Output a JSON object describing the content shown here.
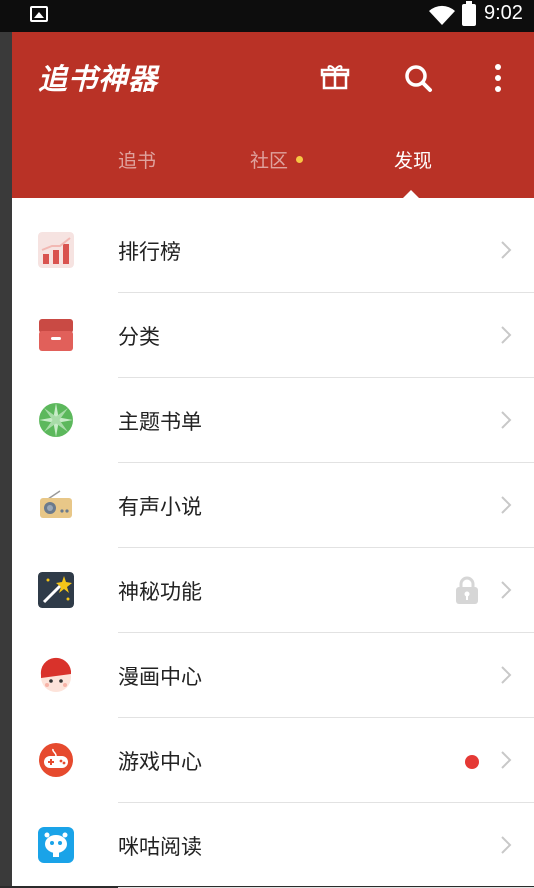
{
  "status_bar": {
    "time": "9:02"
  },
  "header": {
    "title": "追书神器",
    "brand_color": "#b93226"
  },
  "tabs": [
    {
      "label": "追书",
      "active": false
    },
    {
      "label": "社区",
      "active": false,
      "has_badge": true
    },
    {
      "label": "发现",
      "active": true
    }
  ],
  "menu": [
    {
      "label": "排行榜",
      "icon": "ranking-chart-icon"
    },
    {
      "label": "分类",
      "icon": "category-box-icon"
    },
    {
      "label": "主题书单",
      "icon": "theme-booklist-icon"
    },
    {
      "label": "有声小说",
      "icon": "radio-icon"
    },
    {
      "label": "神秘功能",
      "icon": "magic-wand-icon",
      "locked": true
    },
    {
      "label": "漫画中心",
      "icon": "comic-face-icon"
    },
    {
      "label": "游戏中心",
      "icon": "gamepad-icon",
      "has_red_dot": true
    },
    {
      "label": "咪咕阅读",
      "icon": "migu-reading-icon"
    }
  ]
}
